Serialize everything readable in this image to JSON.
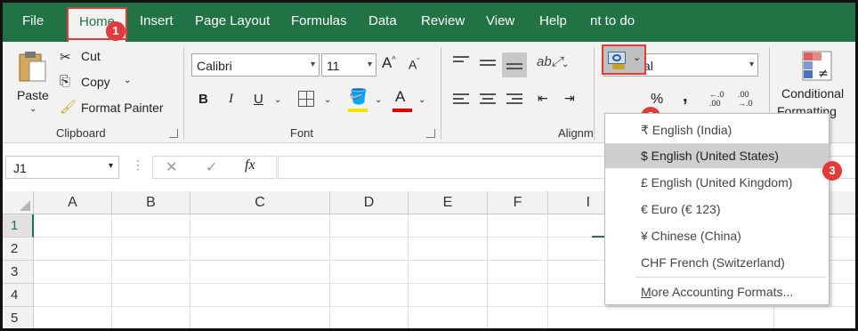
{
  "tabs": [
    "File",
    "Home",
    "Insert",
    "Page Layout",
    "Formulas",
    "Data",
    "Review",
    "View",
    "Help",
    "nt to do"
  ],
  "clipboard": {
    "paste": "Paste",
    "cut": "Cut",
    "copy": "Copy",
    "format_painter": "Format Painter",
    "label": "Clipboard"
  },
  "font": {
    "name": "Calibri",
    "size": "11",
    "bold": "B",
    "italic": "I",
    "underline": "U",
    "font_color_glyph": "A",
    "label": "Font"
  },
  "alignment": {
    "label": "Alignm"
  },
  "number": {
    "format": "General",
    "percent": "%",
    "comma": ",",
    "inc_decimal": "←.0\n.00",
    "dec_decimal": ".00\n→.0"
  },
  "styles": {
    "conditional_formatting_line1": "Conditional",
    "conditional_formatting_line2": "Formatting"
  },
  "formula_bar": {
    "name_box": "J1",
    "cancel": "✕",
    "enter": "✓",
    "fx": "fx"
  },
  "columns": [
    "A",
    "B",
    "C",
    "D",
    "E",
    "F",
    "I"
  ],
  "rows": [
    "1",
    "2",
    "3",
    "4",
    "5"
  ],
  "accounting_menu": {
    "items": [
      "₹ English (India)",
      "$ English (United States)",
      "£ English (United Kingdom)",
      "€ Euro (€ 123)",
      "¥ Chinese (China)",
      "CHF French (Switzerland)"
    ],
    "selected_index": 1,
    "more": "More Accounting Formats..."
  },
  "badges": [
    "1",
    "2",
    "3"
  ],
  "colors": {
    "excel_green": "#217346",
    "highlight_red": "#e03c3c"
  }
}
